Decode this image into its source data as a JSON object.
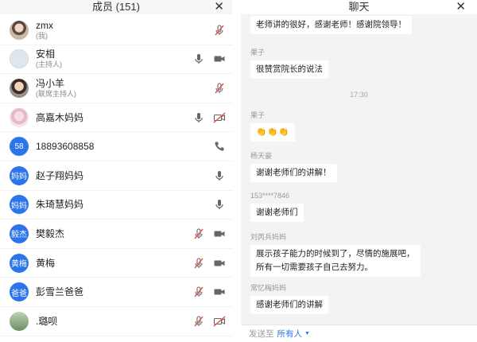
{
  "members_panel": {
    "title": "成员 (151)",
    "close": "✕",
    "members": [
      {
        "name": "zmx",
        "role": "(我)",
        "avatar_text": "",
        "avatar_style": "photo1",
        "icons": [
          "mic-muted-icon"
        ]
      },
      {
        "name": "安相",
        "role": "(主持人)",
        "avatar_text": "",
        "avatar_style": "photo2",
        "icons": [
          "mic-icon",
          "video-icon"
        ]
      },
      {
        "name": "冯小羊",
        "role": "(联席主持人)",
        "avatar_text": "",
        "avatar_style": "photo3",
        "icons": [
          "mic-muted-icon"
        ]
      },
      {
        "name": "高嘉木妈妈",
        "role": "",
        "avatar_text": "",
        "avatar_style": "photo4",
        "icons": [
          "mic-icon",
          "video-off-icon"
        ]
      },
      {
        "name": "18893608858",
        "role": "",
        "avatar_text": "58",
        "avatar_style": "blue",
        "icons": [
          "phone-icon"
        ]
      },
      {
        "name": "赵子翔妈妈",
        "role": "",
        "avatar_text": "妈妈",
        "avatar_style": "blue",
        "icons": [
          "mic-icon"
        ]
      },
      {
        "name": "朱琦慧妈妈",
        "role": "",
        "avatar_text": "妈妈",
        "avatar_style": "blue",
        "icons": [
          "mic-icon"
        ]
      },
      {
        "name": "樊毅杰",
        "role": "",
        "avatar_text": "毅杰",
        "avatar_style": "blue",
        "icons": [
          "mic-muted-icon",
          "video-icon"
        ]
      },
      {
        "name": "黄梅",
        "role": "",
        "avatar_text": "黄梅",
        "avatar_style": "blue",
        "icons": [
          "mic-muted-icon",
          "video-icon"
        ]
      },
      {
        "name": "彭雪兰爸爸",
        "role": "",
        "avatar_text": "爸爸",
        "avatar_style": "blue",
        "icons": [
          "mic-muted-icon",
          "video-icon"
        ]
      },
      {
        "name": ".璐呗",
        "role": "",
        "avatar_text": "",
        "avatar_style": "photo5",
        "icons": [
          "mic-muted-icon",
          "video-off-icon"
        ]
      }
    ]
  },
  "chat_panel": {
    "title": "聊天",
    "close": "✕",
    "messages": [
      {
        "sender": "",
        "text": "老师讲的很好，感谢老师！感谢院领导！"
      },
      {
        "sender": "果子",
        "text": "很赞赏院长的说法"
      },
      {
        "sender": "果子",
        "text": "👏👏👏"
      },
      {
        "sender": "杨天豪",
        "text": "谢谢老师们的讲解！"
      },
      {
        "sender": "153****7846",
        "text": "谢谢老师们"
      },
      {
        "sender": "刘芮兵妈妈",
        "text": "展示孩子能力的时候到了，尽情的施展吧，\n所有一切需要孩子自己去努力。"
      },
      {
        "sender": "常忆梅妈妈",
        "text": "感谢老师们的讲解"
      }
    ],
    "timestamp": "17:30",
    "footer": {
      "label": "发送至",
      "target": "所有人",
      "caret": "▼"
    }
  },
  "colors": {
    "accent": "#2b74ea",
    "muted_red": "#e0524d",
    "icon_gray": "#666666"
  }
}
